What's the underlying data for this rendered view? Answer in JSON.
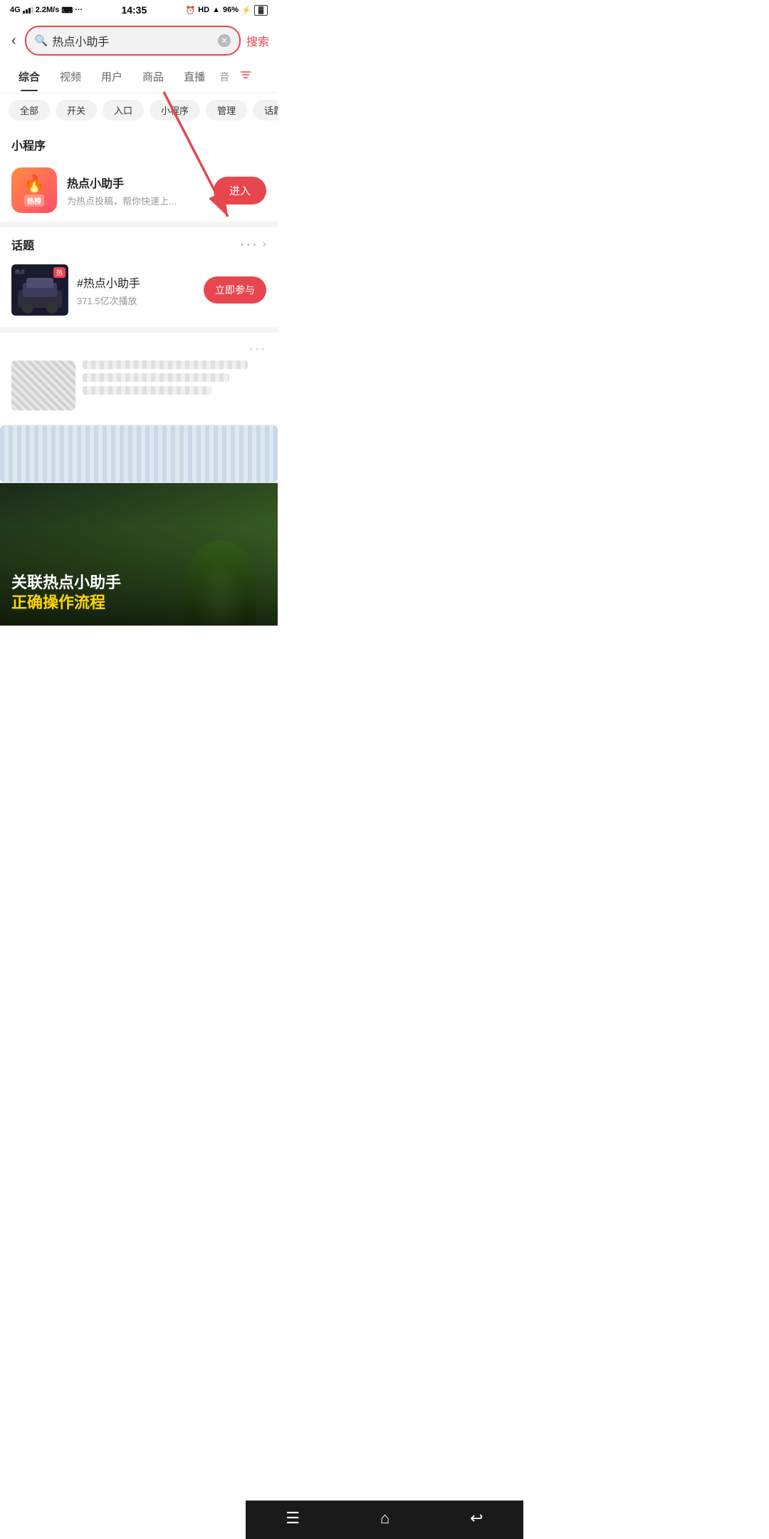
{
  "statusBar": {
    "signal": "4G",
    "bars": "..ll",
    "speed": "2.2M/s",
    "usb": "⌨",
    "time": "14:35",
    "alarm": "🕐",
    "hd": "HD",
    "wifi": "WiFi",
    "battery": "96%"
  },
  "searchBar": {
    "backLabel": "‹",
    "placeholder": "热点小助手",
    "searchBtnLabel": "搜索"
  },
  "tabs": [
    {
      "label": "综合",
      "active": true
    },
    {
      "label": "视频",
      "active": false
    },
    {
      "label": "用户",
      "active": false
    },
    {
      "label": "商品",
      "active": false
    },
    {
      "label": "直播",
      "active": false
    },
    {
      "label": "音",
      "active": false
    }
  ],
  "chips": [
    {
      "label": "全部",
      "active": false
    },
    {
      "label": "开关",
      "active": false
    },
    {
      "label": "入口",
      "active": false
    },
    {
      "label": "小程序",
      "active": false
    },
    {
      "label": "管理",
      "active": false
    },
    {
      "label": "话题",
      "active": false
    }
  ],
  "miniProgram": {
    "sectionTitle": "小程序",
    "name": "热点小助手",
    "desc": "为热点投稿，帮你快速上...",
    "enterBtnLabel": "进入",
    "iconFireEmoji": "🔥",
    "iconText": "热榜"
  },
  "topicSection": {
    "sectionTitle": "话题",
    "topicName": "#热点小助手",
    "topicStats": "371.5亿次播放",
    "participateBtnLabel": "立即参与"
  },
  "videoCard": {
    "titleLine1": "关联热点小助手",
    "titleLine2": "正确操作流程"
  },
  "bottomNav": {
    "menuIcon": "☰",
    "homeIcon": "⌂",
    "backIcon": "↩"
  },
  "annotation": {
    "searchBoxHighlight": true
  }
}
